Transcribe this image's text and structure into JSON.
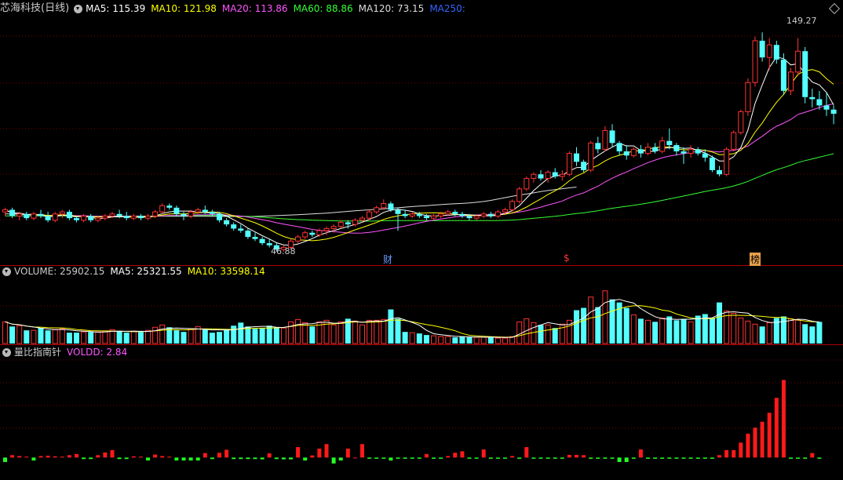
{
  "header": {
    "title": "芯海科技(日线)",
    "ma5": "MA5: 115.39",
    "ma10": "MA10: 121.98",
    "ma20": "MA20: 113.86",
    "ma60": "MA60: 88.86",
    "ma120": "MA120: 73.15",
    "ma250": "MA250:"
  },
  "volume_header": {
    "title": "VOLUME: 25902.15",
    "ma5": "MA5: 25321.55",
    "ma10": "MA10: 33598.14"
  },
  "indicator_header": {
    "title": "量比指南针",
    "voldd": "VOLDD: 2.84"
  },
  "annotations": {
    "high_label": "149.27",
    "low_label": "46.88",
    "marker_cai": "财",
    "marker_dollar": "$",
    "marker_bang": "榜"
  },
  "colors": {
    "up": "#ff3333",
    "down": "#54ffff",
    "ma5": "#ffffff",
    "ma10": "#ffff00",
    "ma20": "#ff55ff",
    "ma60": "#33ff33",
    "ma120": "#dddddd",
    "ma250": "#3366ff",
    "grid": "#7a0000"
  },
  "chart_data": [
    {
      "type": "candlestick",
      "title": "芯海科技(日线)",
      "ylim": [
        42,
        160
      ],
      "annotations": [
        {
          "label": "149.27",
          "value": 149.27
        },
        {
          "label": "46.88",
          "value": 46.88
        }
      ],
      "series": [
        {
          "name": "MA5",
          "value": 115.39
        },
        {
          "name": "MA10",
          "value": 121.98
        },
        {
          "name": "MA20",
          "value": 113.86
        },
        {
          "name": "MA60",
          "value": 88.86
        },
        {
          "name": "MA120",
          "value": 73.15
        },
        {
          "name": "MA250",
          "value": null
        }
      ],
      "ohlc": [
        [
          66,
          68,
          64,
          67
        ],
        [
          67,
          68,
          63,
          64
        ],
        [
          64,
          66,
          62,
          65
        ],
        [
          65,
          66,
          62,
          63
        ],
        [
          63,
          66,
          62,
          65
        ],
        [
          65,
          67,
          63,
          64
        ],
        [
          64,
          66,
          61,
          62
        ],
        [
          62,
          66,
          61,
          65
        ],
        [
          65,
          67,
          63,
          66
        ],
        [
          66,
          67,
          62,
          63
        ],
        [
          63,
          64,
          61,
          62
        ],
        [
          62,
          65,
          61,
          64
        ],
        [
          64,
          65,
          61,
          62
        ],
        [
          62,
          64,
          61,
          63
        ],
        [
          63,
          65,
          62,
          64
        ],
        [
          64,
          66,
          63,
          65
        ],
        [
          65,
          67,
          63,
          64
        ],
        [
          64,
          66,
          62,
          63
        ],
        [
          63,
          65,
          62,
          64
        ],
        [
          64,
          65,
          62,
          63
        ],
        [
          63,
          65,
          62,
          64
        ],
        [
          64,
          67,
          63,
          66
        ],
        [
          66,
          70,
          65,
          69
        ],
        [
          69,
          70,
          67,
          68
        ],
        [
          68,
          69,
          64,
          65
        ],
        [
          65,
          66,
          62,
          64
        ],
        [
          64,
          67,
          63,
          66
        ],
        [
          66,
          68,
          65,
          67
        ],
        [
          67,
          69,
          65,
          66
        ],
        [
          66,
          67,
          64,
          65
        ],
        [
          65,
          66,
          61,
          62
        ],
        [
          62,
          63,
          59,
          60
        ],
        [
          60,
          61,
          57,
          58
        ],
        [
          58,
          60,
          56,
          57
        ],
        [
          57,
          58,
          53,
          54
        ],
        [
          54,
          56,
          52,
          53
        ],
        [
          53,
          54,
          50,
          51
        ],
        [
          51,
          53,
          49,
          50
        ],
        [
          50,
          51,
          47,
          48
        ],
        [
          48,
          50,
          46.88,
          49
        ],
        [
          49,
          53,
          48,
          52
        ],
        [
          52,
          55,
          51,
          54
        ],
        [
          54,
          57,
          53,
          56
        ],
        [
          56,
          57,
          54,
          55
        ],
        [
          55,
          58,
          54,
          57
        ],
        [
          57,
          59,
          55,
          58
        ],
        [
          58,
          60,
          56,
          59
        ],
        [
          59,
          62,
          58,
          61
        ],
        [
          61,
          62,
          58,
          60
        ],
        [
          60,
          63,
          59,
          62
        ],
        [
          62,
          64,
          61,
          63
        ],
        [
          63,
          67,
          62,
          66
        ],
        [
          66,
          69,
          65,
          68
        ],
        [
          68,
          72,
          67,
          70
        ],
        [
          70,
          71,
          66,
          67
        ],
        [
          67,
          68,
          57,
          65
        ],
        [
          65,
          67,
          63,
          64
        ],
        [
          64,
          66,
          63,
          65
        ],
        [
          65,
          66,
          63,
          64
        ],
        [
          64,
          65,
          62,
          63
        ],
        [
          63,
          65,
          62,
          64
        ],
        [
          64,
          66,
          63,
          65
        ],
        [
          65,
          67,
          64,
          66
        ],
        [
          66,
          67,
          64,
          65
        ],
        [
          65,
          66,
          63,
          64
        ],
        [
          64,
          65,
          62,
          63
        ],
        [
          63,
          65,
          62,
          64
        ],
        [
          64,
          66,
          63,
          65
        ],
        [
          65,
          66,
          63,
          64
        ],
        [
          64,
          67,
          63,
          66
        ],
        [
          66,
          68,
          65,
          67
        ],
        [
          67,
          72,
          66,
          71
        ],
        [
          71,
          78,
          70,
          77
        ],
        [
          77,
          83,
          76,
          82
        ],
        [
          82,
          85,
          80,
          84
        ],
        [
          84,
          86,
          81,
          82
        ],
        [
          82,
          86,
          80,
          85
        ],
        [
          85,
          87,
          82,
          83
        ],
        [
          83,
          86,
          81,
          84
        ],
        [
          84,
          95,
          83,
          94
        ],
        [
          94,
          97,
          88,
          90
        ],
        [
          90,
          91,
          85,
          86
        ],
        [
          86,
          100,
          85,
          99
        ],
        [
          99,
          102,
          94,
          96
        ],
        [
          96,
          107,
          95,
          105
        ],
        [
          105,
          108,
          97,
          99
        ],
        [
          99,
          100,
          93,
          95
        ],
        [
          95,
          98,
          91,
          93
        ],
        [
          93,
          97,
          92,
          96
        ],
        [
          96,
          98,
          92,
          94
        ],
        [
          94,
          99,
          93,
          97
        ],
        [
          97,
          99,
          94,
          95
        ],
        [
          95,
          102,
          94,
          100
        ],
        [
          100,
          106,
          96,
          98
        ],
        [
          98,
          99,
          93,
          95
        ],
        [
          95,
          97,
          89,
          94
        ],
        [
          94,
          98,
          92,
          96
        ],
        [
          96,
          97,
          93,
          94
        ],
        [
          94,
          96,
          90,
          92
        ],
        [
          92,
          93,
          85,
          86
        ],
        [
          86,
          88,
          83,
          84
        ],
        [
          84,
          97,
          83,
          96
        ],
        [
          96,
          105,
          95,
          104
        ],
        [
          104,
          115,
          103,
          114
        ],
        [
          114,
          130,
          112,
          128
        ],
        [
          128,
          150,
          126,
          148
        ],
        [
          148,
          152,
          138,
          140
        ],
        [
          140,
          149.27,
          134,
          146
        ],
        [
          146,
          148,
          137,
          139
        ],
        [
          139,
          142,
          122,
          124
        ],
        [
          124,
          135,
          122,
          133
        ],
        [
          133,
          149.27,
          131,
          143
        ],
        [
          143,
          145,
          118,
          121
        ],
        [
          121,
          125,
          116,
          120
        ],
        [
          120,
          124,
          115,
          117
        ],
        [
          117,
          123,
          112,
          115
        ],
        [
          115,
          117,
          108,
          113
        ]
      ]
    },
    {
      "type": "bar",
      "title": "VOLUME: 25902.15",
      "ylim": [
        0,
        85000
      ],
      "series": [
        {
          "name": "MA5",
          "value": 25321.55
        },
        {
          "name": "MA10",
          "value": 33598.14
        }
      ],
      "values": [
        28000,
        22000,
        23000,
        17000,
        17000,
        20000,
        17000,
        18000,
        19000,
        14000,
        14000,
        15000,
        15000,
        15000,
        16000,
        18000,
        16000,
        14000,
        16000,
        15000,
        17000,
        21000,
        24000,
        21000,
        17000,
        15000,
        19000,
        22000,
        18000,
        14000,
        15000,
        18000,
        23000,
        27000,
        22000,
        19000,
        20000,
        23000,
        21000,
        20000,
        28000,
        31000,
        27000,
        22000,
        28000,
        30000,
        24000,
        28000,
        32000,
        29000,
        24000,
        30000,
        30000,
        31000,
        44000,
        32000,
        15000,
        14000,
        13000,
        11000,
        10000,
        9000,
        9000,
        8000,
        9000,
        8000,
        8000,
        8000,
        9000,
        7000,
        7000,
        9000,
        28000,
        32000,
        27000,
        24000,
        24000,
        20000,
        25000,
        30000,
        43000,
        46000,
        60000,
        47000,
        68000,
        57000,
        53000,
        46000,
        37000,
        32000,
        30000,
        28000,
        33000,
        35000,
        30000,
        31000,
        28000,
        36000,
        38000,
        33000,
        53000,
        42000,
        39000,
        33000,
        29000,
        25000,
        22000,
        27000,
        33000,
        35000,
        32000,
        30000,
        25000,
        22000,
        28000
      ]
    },
    {
      "type": "bar",
      "title": "量比指南针",
      "series": [
        {
          "name": "VOLDD",
          "value": 2.84
        }
      ],
      "ylim": [
        -7,
        34
      ],
      "values": [
        -1.5,
        0.8,
        0.5,
        0.3,
        -1,
        0.5,
        0.6,
        0.4,
        0.3,
        0.8,
        1.2,
        -0.5,
        -0.5,
        0.8,
        1.7,
        2.5,
        -0.5,
        -0.5,
        0.4,
        0.3,
        -1,
        1,
        0.5,
        0.3,
        -1,
        -1,
        -1,
        -1,
        1.5,
        -0.5,
        1.6,
        2.6,
        -0.5,
        -0.5,
        -0.5,
        -0.5,
        -0.6,
        1.4,
        -0.5,
        -0.6,
        -0.6,
        3.5,
        -1,
        0.7,
        3,
        4.5,
        -2,
        -1,
        3,
        0,
        4.5,
        -0.4,
        -0.4,
        -0.4,
        -1,
        -0.4,
        -0.4,
        -0.4,
        -0.4,
        1.2,
        -0.4,
        -0.4,
        0.5,
        1.6,
        2.1,
        -0.4,
        -0.4,
        2.7,
        -0.4,
        -0.4,
        -0.4,
        0.5,
        -0.4,
        3.5,
        -0.4,
        -0.4,
        -0.4,
        -0.4,
        -0.4,
        0.9,
        0.9,
        0.8,
        -0.4,
        -0.4,
        -0.4,
        -0.4,
        -1.5,
        -1.5,
        -0.4,
        2.7,
        -0.4,
        -0.4,
        -0.4,
        -0.4,
        -0.4,
        -0.4,
        -0.4,
        -0.4,
        -0.4,
        -0.4,
        0.8,
        2.5,
        2.5,
        5,
        8,
        10,
        12,
        15,
        20,
        26,
        -0.4,
        -0.4,
        -0.4,
        1.5,
        -0.4
      ]
    }
  ]
}
